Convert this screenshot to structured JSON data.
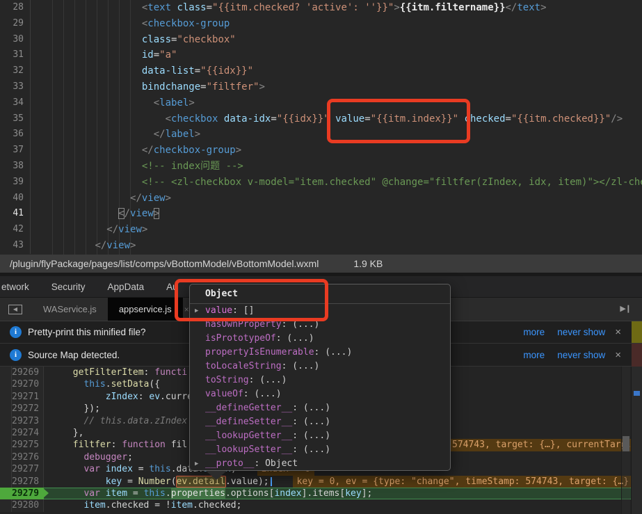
{
  "colors": {
    "annotation_red": "#e93b22",
    "exec_green": "#4ea83c",
    "link_blue": "#3b96ff",
    "string_orange": "#ce9178",
    "tag_blue": "#569cd6"
  },
  "statusbar": {
    "path": "/plugin/flyPackage/pages/list/comps/vBottomModel/vBottomModel.wxml",
    "size": "1.9 KB"
  },
  "editor": {
    "lines": [
      {
        "n": "28",
        "ind": 16,
        "seg": [
          [
            "punc",
            "<"
          ],
          [
            "tag",
            "text"
          ],
          [
            "pl",
            " "
          ],
          [
            "attr",
            "class"
          ],
          [
            "op",
            "="
          ],
          [
            "str",
            "\"{{itm.checked? 'active': ''}}\""
          ],
          [
            "punc",
            ">"
          ],
          [
            "must",
            "{{itm.filtername}}"
          ],
          [
            "punc",
            "</"
          ],
          [
            "tag",
            "text"
          ],
          [
            "punc",
            ">"
          ]
        ]
      },
      {
        "n": "29",
        "ind": 16,
        "seg": [
          [
            "punc",
            "<"
          ],
          [
            "tag",
            "checkbox-group"
          ]
        ]
      },
      {
        "n": "30",
        "ind": 16,
        "seg": [
          [
            "attr",
            "class"
          ],
          [
            "op",
            "="
          ],
          [
            "str",
            "\"checkbox\""
          ]
        ]
      },
      {
        "n": "31",
        "ind": 16,
        "seg": [
          [
            "attr",
            "id"
          ],
          [
            "op",
            "="
          ],
          [
            "str",
            "\"a\""
          ]
        ]
      },
      {
        "n": "32",
        "ind": 16,
        "seg": [
          [
            "attr",
            "data-list"
          ],
          [
            "op",
            "="
          ],
          [
            "str",
            "\"{{idx}}\""
          ]
        ]
      },
      {
        "n": "33",
        "ind": 16,
        "seg": [
          [
            "attr",
            "bindchange"
          ],
          [
            "op",
            "="
          ],
          [
            "str",
            "\"filtfer\""
          ],
          [
            "punc",
            ">"
          ]
        ]
      },
      {
        "n": "34",
        "ind": 18,
        "seg": [
          [
            "punc",
            "<"
          ],
          [
            "tag",
            "label"
          ],
          [
            "punc",
            ">"
          ]
        ]
      },
      {
        "n": "35",
        "ind": 20,
        "seg": [
          [
            "punc",
            "<"
          ],
          [
            "tag",
            "checkbox"
          ],
          [
            "pl",
            " "
          ],
          [
            "attr",
            "data-idx"
          ],
          [
            "op",
            "="
          ],
          [
            "str",
            "\"{{idx}}\""
          ],
          [
            "pl",
            " "
          ],
          [
            "attr",
            "value"
          ],
          [
            "op",
            "="
          ],
          [
            "str",
            "\"{{itm.index}}\""
          ],
          [
            "pl",
            " "
          ],
          [
            "attr",
            "checked"
          ],
          [
            "op",
            "="
          ],
          [
            "str",
            "\"{{itm.checked}}\""
          ],
          [
            "punc",
            "/>"
          ]
        ]
      },
      {
        "n": "36",
        "ind": 18,
        "seg": [
          [
            "punc",
            "</"
          ],
          [
            "tag",
            "label"
          ],
          [
            "punc",
            ">"
          ]
        ]
      },
      {
        "n": "37",
        "ind": 16,
        "seg": [
          [
            "punc",
            "</"
          ],
          [
            "tag",
            "checkbox-group"
          ],
          [
            "punc",
            ">"
          ]
        ]
      },
      {
        "n": "38",
        "ind": 16,
        "seg": [
          [
            "com",
            "<!-- index问题 -->"
          ]
        ]
      },
      {
        "n": "39",
        "ind": 16,
        "seg": [
          [
            "com",
            "<!-- <zl-checkbox v-model=\"item.checked\" @change=\"filtfer(zIndex, idx, item)\"></zl-chec"
          ]
        ]
      },
      {
        "n": "40",
        "ind": 14,
        "seg": [
          [
            "punc",
            "</"
          ],
          [
            "tag",
            "view"
          ],
          [
            "punc",
            ">"
          ]
        ]
      },
      {
        "n": "41",
        "ind": 12,
        "cur": true,
        "seg": [
          [
            "punc brk",
            "<"
          ],
          [
            "punc",
            "/"
          ],
          [
            "tag",
            "view"
          ],
          [
            "punc brk",
            ">"
          ]
        ]
      },
      {
        "n": "42",
        "ind": 10,
        "seg": [
          [
            "punc",
            "</"
          ],
          [
            "tag",
            "view"
          ],
          [
            "punc",
            ">"
          ]
        ]
      },
      {
        "n": "43",
        "ind": 8,
        "seg": [
          [
            "punc",
            "</"
          ],
          [
            "tag",
            "view"
          ],
          [
            "punc",
            ">"
          ]
        ]
      }
    ]
  },
  "devtools": {
    "panel_tabs": [
      "etwork",
      "Security",
      "AppData",
      "Au"
    ],
    "file_tabs": [
      {
        "label": "WAService.js",
        "active": false
      },
      {
        "label": "appservice.js",
        "active": true,
        "close": "×"
      }
    ],
    "dock_icon_glyph": "◀",
    "nav_icon_glyph": "▶❙",
    "infobars": [
      {
        "icon": "i",
        "message": "Pretty-print this minified file?",
        "links": [
          "more",
          "never show"
        ],
        "close": "×"
      },
      {
        "icon": "i",
        "message": "Source Map detected.",
        "links": [
          "more",
          "never show"
        ],
        "close": "×"
      }
    ],
    "source_lines": [
      {
        "n": "29269",
        "ind": 2,
        "seg": [
          [
            "fn",
            "getFilterItem"
          ],
          [
            "pl",
            ": "
          ],
          [
            "kw",
            "functi"
          ]
        ]
      },
      {
        "n": "29270",
        "ind": 4,
        "seg": [
          [
            "th",
            "this"
          ],
          [
            "pl",
            "."
          ],
          [
            "fn",
            "setData"
          ],
          [
            "pl",
            "({"
          ]
        ]
      },
      {
        "n": "29271",
        "ind": 8,
        "seg": [
          [
            "id",
            "zIndex"
          ],
          [
            "pl",
            ": "
          ],
          [
            "id",
            "ev"
          ],
          [
            "pl",
            ".curren"
          ]
        ]
      },
      {
        "n": "29272",
        "ind": 4,
        "seg": [
          [
            "pl",
            "});"
          ]
        ]
      },
      {
        "n": "29273",
        "ind": 4,
        "seg": [
          [
            "cmt",
            "// this.data.zIndex"
          ]
        ]
      },
      {
        "n": "29274",
        "ind": 2,
        "seg": [
          [
            "pl",
            "},"
          ]
        ]
      },
      {
        "n": "29275",
        "ind": 2,
        "seg": [
          [
            "fn",
            "filtfer"
          ],
          [
            "pl",
            ": "
          ],
          [
            "kw",
            "function"
          ],
          [
            "pl",
            " fil"
          ]
        ],
        "tailhint": "574743, target: {…}, currentTarg,"
      },
      {
        "n": "29276",
        "ind": 4,
        "seg": [
          [
            "kw",
            "debugger"
          ],
          [
            "pl",
            ";"
          ]
        ]
      },
      {
        "n": "29277",
        "ind": 4,
        "seg": [
          [
            "kw",
            "var"
          ],
          [
            "pl",
            " "
          ],
          [
            "id",
            "index"
          ],
          [
            "op",
            " = "
          ],
          [
            "th",
            "this"
          ],
          [
            "pl",
            ".data."
          ],
          [
            "id",
            "index"
          ],
          [
            "pl",
            ","
          ],
          [
            "hint",
            "index = 0"
          ]
        ]
      },
      {
        "n": "29278",
        "ind": 8,
        "seg": [
          [
            "id",
            "key"
          ],
          [
            "op",
            " = "
          ],
          [
            "fn",
            "Number"
          ],
          [
            "pl",
            "("
          ],
          [
            "evbox",
            "ev.detail"
          ],
          [
            "pl",
            ".value"
          ],
          [
            "pl",
            ");"
          ],
          [
            "caret",
            ""
          ],
          [
            "hint",
            "key = 0, ev = {type: \"change\", timeStamp: 574743, target: {…}"
          ]
        ]
      },
      {
        "n": "29279",
        "ind": 4,
        "exec": true,
        "seg": [
          [
            "kw",
            "var"
          ],
          [
            "pl",
            " "
          ],
          [
            "id",
            "item"
          ],
          [
            "op",
            " = "
          ],
          [
            "th",
            "this"
          ],
          [
            "pl",
            "."
          ],
          [
            "selhl",
            "properties"
          ],
          [
            "pl",
            ".options["
          ],
          [
            "id",
            "index"
          ],
          [
            "pl",
            "]."
          ],
          [
            "pl",
            "items"
          ],
          [
            "pl",
            "["
          ],
          [
            "id",
            "key"
          ],
          [
            "pl",
            "];"
          ]
        ]
      },
      {
        "n": "29280",
        "ind": 4,
        "seg": [
          [
            "id",
            "item"
          ],
          [
            "pl",
            ".checked = !"
          ],
          [
            "id",
            "item"
          ],
          [
            "pl",
            ".checked;"
          ]
        ]
      }
    ],
    "popup": {
      "title": "Object",
      "rows": [
        {
          "expand": true,
          "own": true,
          "name": "value",
          "value": "[]"
        },
        {
          "name": "hasOwnProperty",
          "value": "(...)"
        },
        {
          "name": "isPrototypeOf",
          "value": "(...)"
        },
        {
          "name": "propertyIsEnumerable",
          "value": "(...)"
        },
        {
          "name": "toLocaleString",
          "value": "(...)"
        },
        {
          "name": "toString",
          "value": "(...)"
        },
        {
          "name": "valueOf",
          "value": "(...)"
        },
        {
          "name": "__defineGetter__",
          "value": "(...)"
        },
        {
          "name": "__defineSetter__",
          "value": "(...)"
        },
        {
          "name": "__lookupGetter__",
          "value": "(...)"
        },
        {
          "name": "__lookupSetter__",
          "value": "(...)"
        },
        {
          "expand": true,
          "name": "__proto__",
          "value": "Object"
        }
      ]
    }
  }
}
